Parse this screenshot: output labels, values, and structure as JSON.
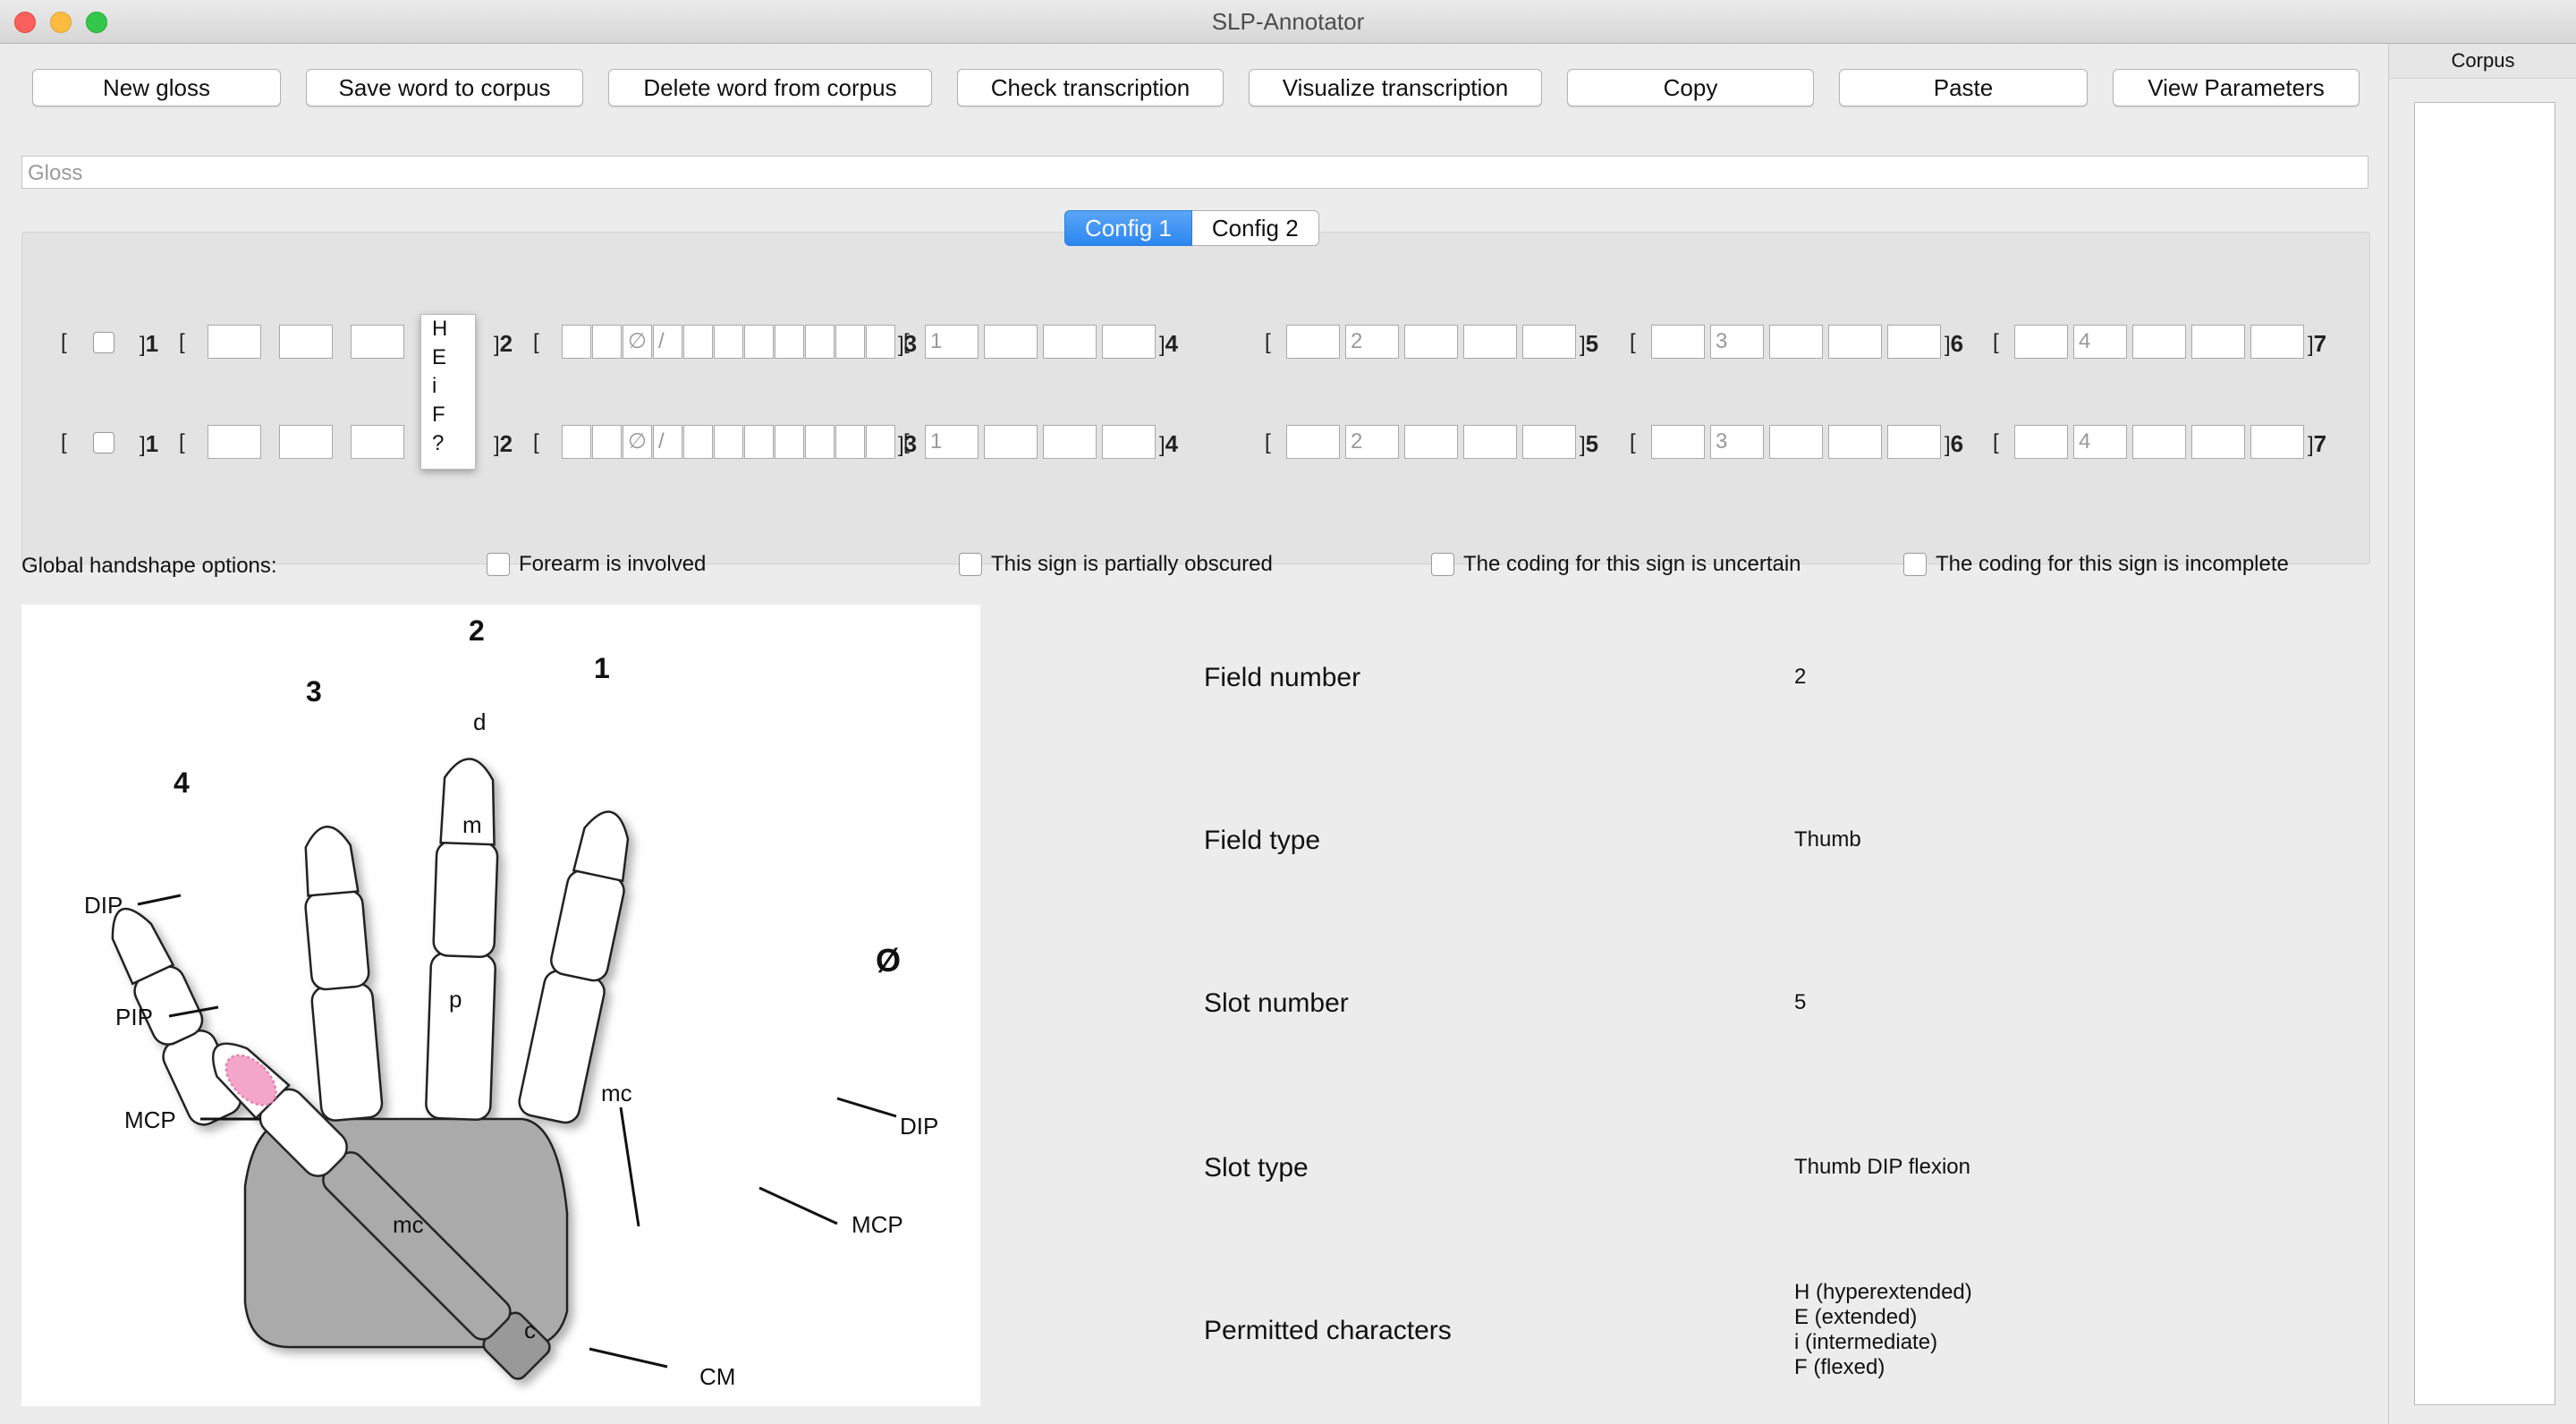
{
  "window": {
    "title": "SLP-Annotator"
  },
  "toolbar": {
    "buttons": [
      {
        "label": "New gloss"
      },
      {
        "label": "Save word to corpus"
      },
      {
        "label": "Delete word from corpus"
      },
      {
        "label": "Check transcription"
      },
      {
        "label": "Visualize transcription"
      },
      {
        "label": "Copy"
      },
      {
        "label": "Paste"
      },
      {
        "label": "View Parameters"
      }
    ]
  },
  "gloss": {
    "placeholder": "Gloss"
  },
  "tabs": [
    {
      "label": "Config 1",
      "active": true
    },
    {
      "label": "Config 2",
      "active": false
    }
  ],
  "transcription": {
    "field_subscripts": [
      "1",
      "2",
      "3",
      "4",
      "5",
      "6",
      "7"
    ],
    "thumb_symbols": [
      "∅",
      "/"
    ],
    "finger_placeholders": [
      "1",
      "2",
      "3",
      "4"
    ]
  },
  "popup": {
    "options": [
      "H",
      "E",
      "i",
      "F",
      "?"
    ]
  },
  "global_options": {
    "label": "Global handshape options:",
    "options": [
      {
        "label": "Forearm is involved"
      },
      {
        "label": "This sign is partially obscured"
      },
      {
        "label": "The coding for this sign is uncertain"
      },
      {
        "label": "The coding for this sign is incomplete"
      }
    ]
  },
  "diagram": {
    "finger_numbers": [
      "4",
      "3",
      "2",
      "1",
      "Ø"
    ],
    "joint_labels": [
      "DIP",
      "PIP",
      "MCP",
      "mc",
      "DIP",
      "MCP",
      "CM"
    ],
    "segment_labels": [
      "d",
      "m",
      "p",
      "mc",
      "c"
    ]
  },
  "info": {
    "field_number": {
      "label": "Field number",
      "value": "2"
    },
    "field_type": {
      "label": "Field type",
      "value": "Thumb"
    },
    "slot_number": {
      "label": "Slot number",
      "value": "5"
    },
    "slot_type": {
      "label": "Slot type",
      "value": "Thumb DIP flexion"
    },
    "permitted": {
      "label": "Permitted characters",
      "values": [
        "H (hyperextended)",
        "E (extended)",
        "i (intermediate)",
        "F (flexed)"
      ]
    }
  },
  "corpus": {
    "title": "Corpus"
  },
  "colors": {
    "accent": "#2c86f0",
    "highlight": "#f4a6c8"
  }
}
